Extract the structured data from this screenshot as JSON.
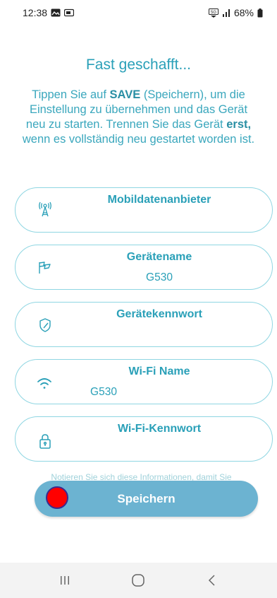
{
  "status_bar": {
    "time": "12:38",
    "battery": "68%"
  },
  "title": "Fast geschafft...",
  "instructions": {
    "part1": "Tippen Sie auf ",
    "save_word": "SAVE",
    "part2": " (Speichern), um die Einstellung zu übernehmen und das Gerät neu zu starten. Trennen Sie das Gerät ",
    "erst_word": "erst,",
    "part3": " wenn es vollständig neu gestartet worden ist."
  },
  "cards": [
    {
      "label": "Mobildatenanbieter",
      "value": "",
      "icon": "cell-tower-icon"
    },
    {
      "label": "Gerätename",
      "value": "G530",
      "icon": "flag-icon"
    },
    {
      "label": "Gerätekennwort",
      "value": "",
      "icon": "shield-icon"
    },
    {
      "label": "Wi-Fi Name",
      "value": "G530",
      "icon": "wifi-icon"
    },
    {
      "label": "Wi-Fi-Kennwort",
      "value": "",
      "icon": "lock-icon"
    }
  ],
  "note": "Notieren Sie sich diese Informationen, damit Sie",
  "save_button": {
    "label": "Speichern"
  },
  "colors": {
    "accent": "#2aa0b8",
    "button": "#6cb3d1",
    "border": "#8fd6e2"
  }
}
